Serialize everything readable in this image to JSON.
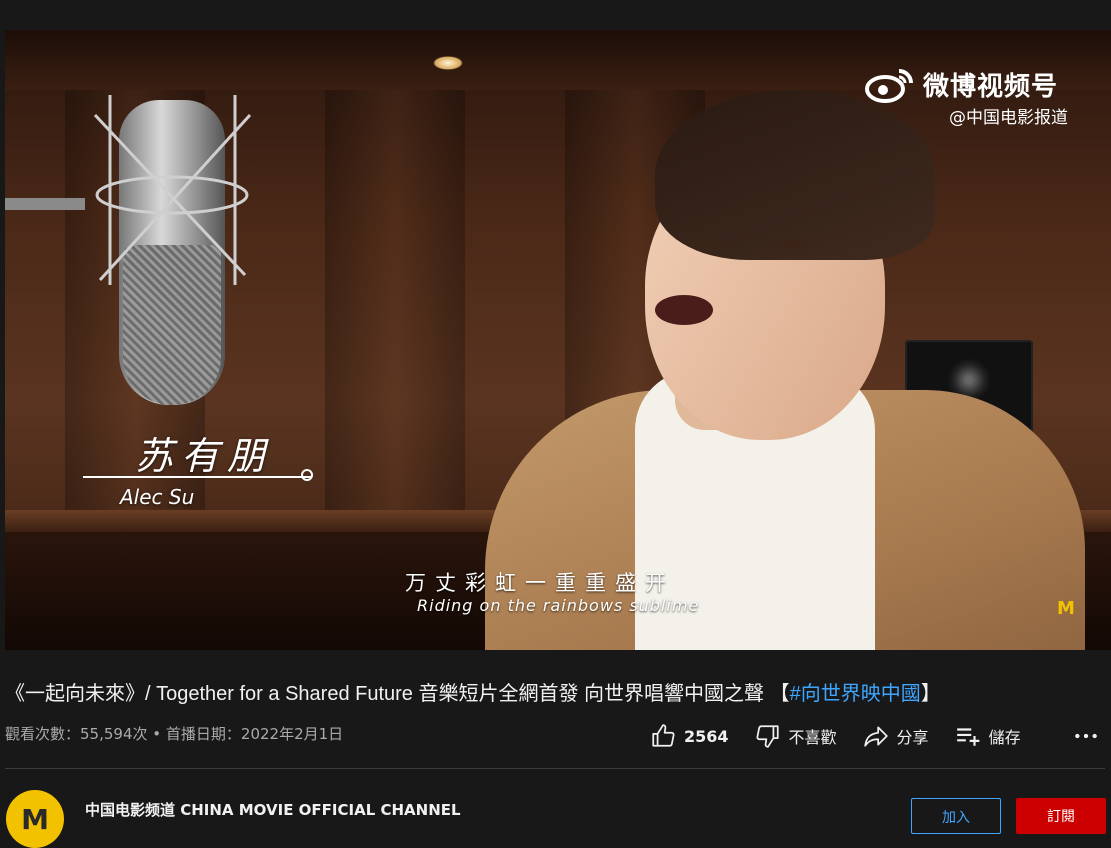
{
  "video": {
    "name_cn": "苏有朋",
    "name_en": "Alec Su",
    "subtitle_cn": "万丈彩虹一重重盛开",
    "subtitle_en": "Riding on the rainbows sublime",
    "watermark_text": "微博视频号",
    "watermark_handle": "@中国电影报道",
    "corner_logo": "M"
  },
  "title": {
    "main": "《一起向未來》/ Together for a Shared Future 音樂短片全網首發 向世界唱響中國之聲 【",
    "hashtag": "#向世界映中國",
    "end": "】"
  },
  "meta": {
    "views_label": "觀看次數：",
    "views": "55,594次",
    "separator": " • ",
    "premiere_label": "首播日期：",
    "premiere_date": "2022年2月1日"
  },
  "actions": {
    "like_count": "2564",
    "dislike_label": "不喜歡",
    "share_label": "分享",
    "save_label": "儲存",
    "icons": [
      "thumbs-up-icon",
      "thumbs-down-icon",
      "share-icon",
      "save-playlist-icon",
      "more-icon"
    ]
  },
  "channel": {
    "name": "中国电影频道 CHINA MOVIE OFFICIAL CHANNEL",
    "avatar_letter": "M",
    "join_label": "加入",
    "subscribe_label": "訂閱"
  },
  "colors": {
    "background": "#181818",
    "link": "#3ea6ff",
    "subscribe": "#cc0000",
    "brand_yellow": "#f2c200"
  }
}
